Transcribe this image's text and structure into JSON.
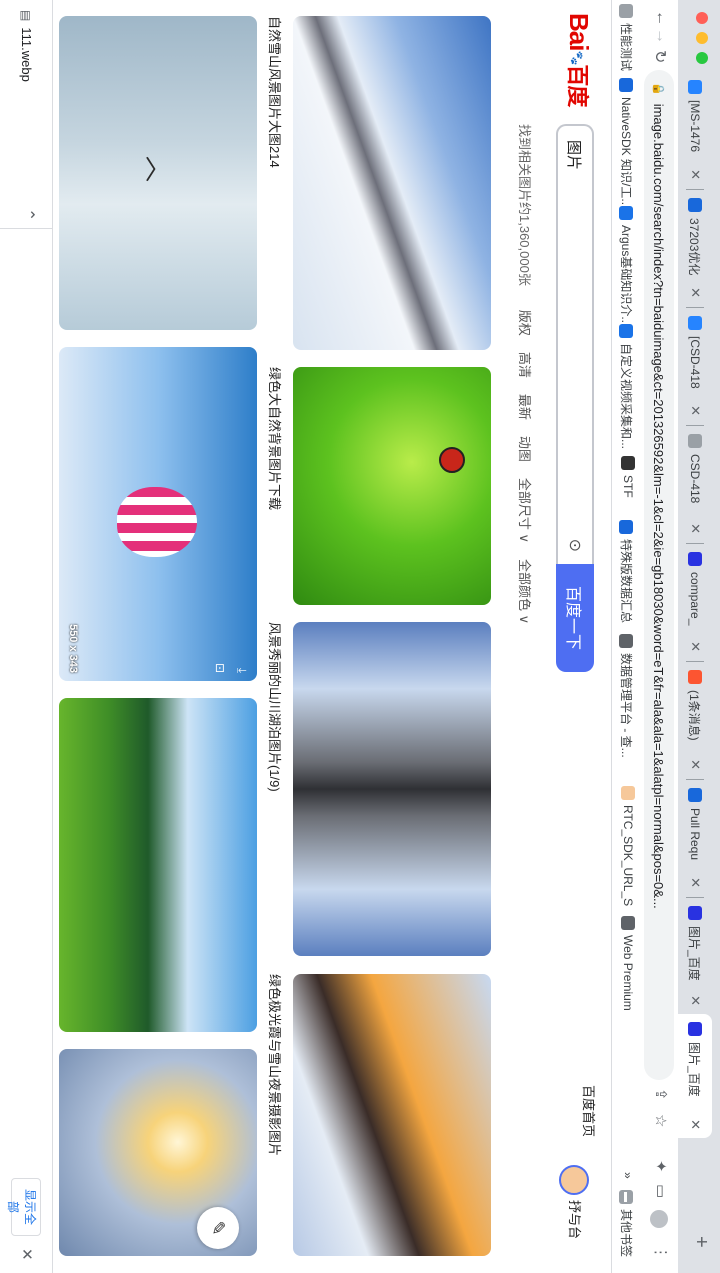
{
  "browser": {
    "tabs": [
      {
        "title": "[MS-1476",
        "icon": "jira-icon",
        "color": "#2684ff"
      },
      {
        "title": "37203优化",
        "icon": "confluence-icon",
        "color": "#1868db"
      },
      {
        "title": "[CSD-418",
        "icon": "jira-icon",
        "color": "#2684ff"
      },
      {
        "title": "CSD-418",
        "icon": "doc-icon",
        "color": "#9aa0a6"
      },
      {
        "title": "compare_",
        "icon": "baidu-paw-icon",
        "color": "#2932e1"
      },
      {
        "title": "(1条消息)",
        "icon": "csdn-icon",
        "color": "#fc5531"
      },
      {
        "title": "Pull Requ",
        "icon": "pr-icon",
        "color": "#1868db"
      },
      {
        "title": "图片_百度",
        "icon": "baidu-paw-icon",
        "color": "#2932e1"
      },
      {
        "title": "图片_百度",
        "icon": "baidu-paw-icon",
        "color": "#2932e1",
        "active": true
      }
    ],
    "url": "image.baidu.com/search/index?tn=baiduimage&ct=201326592&lm=-1&cl=2&ie=gb18030&word=eT&fr=ala&ala=1&alatpl=normal&pos=0&...",
    "bookmarks": [
      {
        "label": "性能测试",
        "icon": "folder-icon"
      },
      {
        "label": "NativeSDK 知识/工...",
        "icon": "confluence-icon"
      },
      {
        "label": "Argus基础知识介...",
        "icon": "argus-icon"
      },
      {
        "label": "自定义视频采集和...",
        "icon": "c-icon"
      },
      {
        "label": "STF",
        "icon": "stf-icon"
      },
      {
        "label": "特殊版数据汇总",
        "icon": "confluence-icon"
      },
      {
        "label": "数据管理平台 - 查...",
        "icon": "globe-icon"
      },
      {
        "label": "RTC_SDK_URL_S",
        "icon": "avatar-icon"
      },
      {
        "label": "Web Premium",
        "icon": "globe-icon"
      }
    ],
    "more": "»",
    "other_bookmarks": "其他书签"
  },
  "page": {
    "logo": {
      "bai": "Bai",
      "du": "百度"
    },
    "search_query": "图片",
    "search_button": "百度一下",
    "home_link": "百度首页",
    "username": "抒与台",
    "result_count": "找到相关图片约1,360,000张",
    "filters": [
      "版权",
      "高清",
      "最新",
      "动图",
      "全部尺寸 ∨",
      "全部颜色 ∨"
    ],
    "captions": [
      "自然雪山风景图片大图214",
      "绿色大自然背景图片下载",
      "风景秀丽的山川湖泊图片(1/9)",
      "绿色极光霞与雪山夜景摄影图片"
    ],
    "dimension_label": "550 x 343"
  },
  "download": {
    "file": "111.webp",
    "show_all": "显示全部"
  },
  "colors": {
    "accent": "#4e6ef2",
    "baidu_red": "#e10601",
    "baidu_blue": "#2932e1"
  }
}
